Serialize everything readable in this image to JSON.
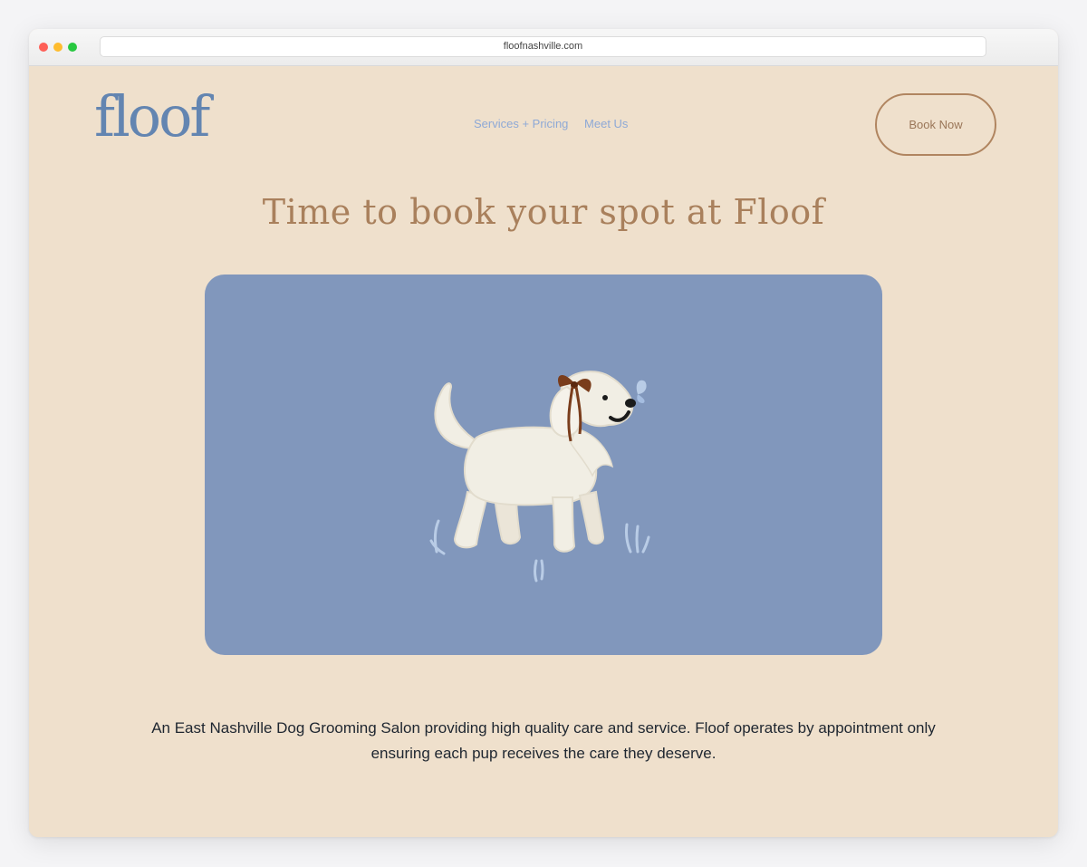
{
  "browser": {
    "url": "floofnashville.com"
  },
  "header": {
    "logo_text": "floof",
    "nav": [
      {
        "label": "Services + Pricing"
      },
      {
        "label": "Meet Us"
      }
    ],
    "cta_label": "Book Now"
  },
  "main": {
    "headline": "Time to book your spot at Floof",
    "hero_icon": "dog-with-bow-illustration",
    "description": "An East Nashville Dog Grooming Salon providing high quality care and service. Floof operates by appointment only ensuring each pup receives the care they deserve."
  },
  "colors": {
    "page_background": "#efe0cc",
    "brand_blue": "#6385b1",
    "nav_link": "#8ea9d6",
    "accent_brown": "#a9805c",
    "hero_background": "#8197bc"
  }
}
